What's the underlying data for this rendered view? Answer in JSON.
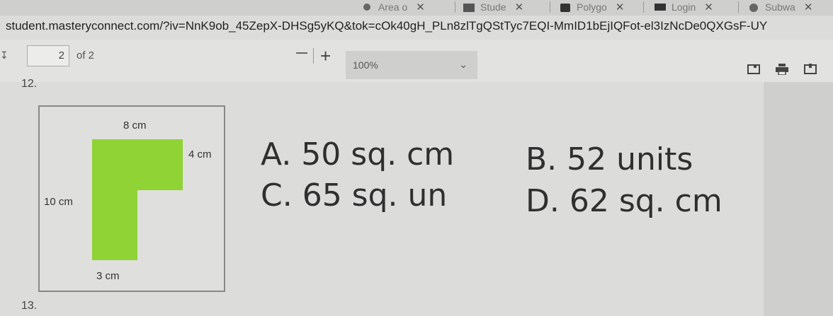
{
  "tabs": [
    {
      "label": "Area o",
      "icon": "globe-icon"
    },
    {
      "label": "Stude",
      "icon": "grid-icon"
    },
    {
      "label": "Polygo",
      "icon": "q-icon"
    },
    {
      "label": "Login",
      "icon": "book-icon"
    },
    {
      "label": "Subwa",
      "icon": "globe-icon"
    }
  ],
  "tab_close": "✕",
  "address": {
    "url": "student.masteryconnect.com/?iv=NnK9ob_45ZepX-DHSg5yKQ&tok=cOk40gH_PLn8zlTgQStTyc7EQI-MmID1bEjIQFot-el3IzNcDe0QXGsF-UY"
  },
  "pdf_toolbar": {
    "page_current": "2",
    "page_of": "of 2",
    "zoom": "100%"
  },
  "questions": {
    "q12_number": "12.",
    "q13_number": "13."
  },
  "figure": {
    "top_label": "8 cm",
    "right_label": "4 cm",
    "left_label": "10 cm",
    "bottom_label": "3 cm",
    "shape_color": "#8fd334"
  },
  "answers": {
    "a": "A. 50 sq. cm",
    "b": "B. 52 units",
    "c": "C. 65 sq. un",
    "d": "D. 62 sq. cm"
  }
}
